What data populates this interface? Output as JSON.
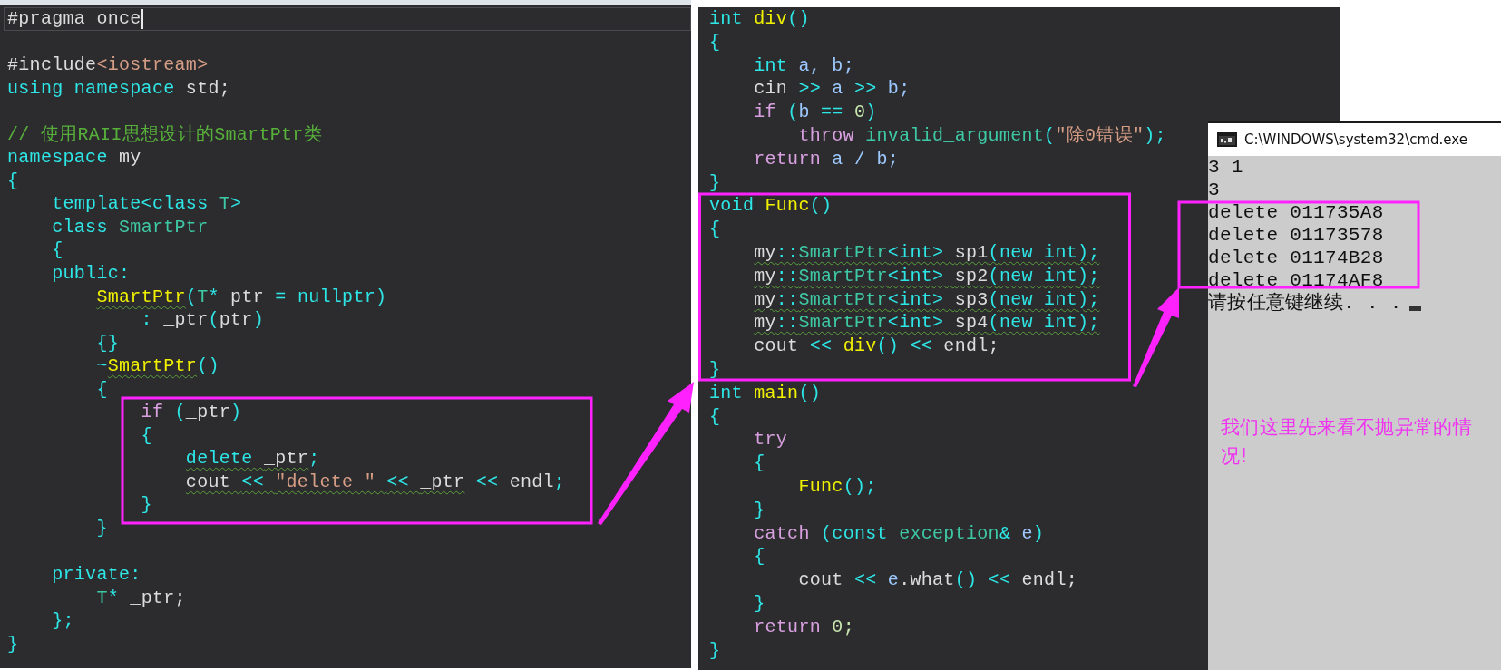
{
  "editors": [
    {
      "lines": [
        {
          "kind": "code",
          "current": true,
          "tokens": [
            {
              "text": "#pragma once",
              "kind": "id"
            }
          ]
        },
        {
          "kind": "blank"
        },
        {
          "kind": "code",
          "tokens": [
            {
              "text": "#include",
              "kind": "id"
            },
            {
              "text": "<iostream>",
              "kind": "str"
            }
          ]
        },
        {
          "kind": "code",
          "tokens": [
            {
              "text": "using namespace ",
              "kind": "kw"
            },
            {
              "text": "std;",
              "kind": "id"
            }
          ]
        },
        {
          "kind": "blank"
        },
        {
          "kind": "code",
          "tokens": [
            {
              "text": "// 使用RAII思想设计的SmartPtr类",
              "kind": "cmt"
            }
          ]
        },
        {
          "kind": "code",
          "tokens": [
            {
              "text": "namespace ",
              "kind": "kw"
            },
            {
              "text": "my",
              "kind": "id"
            }
          ]
        },
        {
          "kind": "code",
          "tokens": [
            {
              "text": "{",
              "kind": "punc"
            }
          ]
        },
        {
          "kind": "code",
          "tokens": [
            {
              "text": "    template<class ",
              "kind": "kw"
            },
            {
              "text": "T",
              "kind": "type"
            },
            {
              "text": ">",
              "kind": "punc"
            }
          ]
        },
        {
          "kind": "code",
          "tokens": [
            {
              "text": "    class ",
              "kind": "kw"
            },
            {
              "text": "SmartPtr",
              "kind": "type"
            }
          ]
        },
        {
          "kind": "code",
          "tokens": [
            {
              "text": "    {",
              "kind": "punc"
            }
          ]
        },
        {
          "kind": "code",
          "tokens": [
            {
              "text": "    public:",
              "kind": "kw"
            }
          ]
        },
        {
          "kind": "code",
          "tokens": [
            {
              "text": "        SmartPtr",
              "kind": "fn",
              "squiggly": true
            },
            {
              "text": "(",
              "kind": "punc"
            },
            {
              "text": "T",
              "kind": "type"
            },
            {
              "text": "* ",
              "kind": "punc"
            },
            {
              "text": "ptr ",
              "kind": "id"
            },
            {
              "text": "= ",
              "kind": "punc"
            },
            {
              "text": "nullptr",
              "kind": "kw"
            },
            {
              "text": ")",
              "kind": "punc"
            }
          ]
        },
        {
          "kind": "code",
          "tokens": [
            {
              "text": "            : ",
              "kind": "punc"
            },
            {
              "text": "_ptr",
              "kind": "id"
            },
            {
              "text": "(",
              "kind": "punc"
            },
            {
              "text": "ptr",
              "kind": "id"
            },
            {
              "text": ")",
              "kind": "punc"
            }
          ]
        },
        {
          "kind": "code",
          "tokens": [
            {
              "text": "        {}",
              "kind": "punc"
            }
          ]
        },
        {
          "kind": "code",
          "tokens": [
            {
              "text": "        ~",
              "kind": "punc"
            },
            {
              "text": "SmartPtr",
              "kind": "fn",
              "squiggly": true
            },
            {
              "text": "()",
              "kind": "punc"
            }
          ]
        },
        {
          "kind": "code",
          "tokens": [
            {
              "text": "        {",
              "kind": "punc"
            }
          ]
        },
        {
          "kind": "code",
          "tokens": [
            {
              "text": "            if ",
              "kind": "ctrl"
            },
            {
              "text": "(",
              "kind": "punc"
            },
            {
              "text": "_ptr",
              "kind": "id"
            },
            {
              "text": ")",
              "kind": "punc"
            }
          ]
        },
        {
          "kind": "code",
          "tokens": [
            {
              "text": "            {",
              "kind": "punc"
            }
          ]
        },
        {
          "kind": "code",
          "tokens": [
            {
              "text": "                delete ",
              "kind": "kw",
              "squiggly": true
            },
            {
              "text": "_ptr",
              "kind": "id",
              "squiggly": true
            },
            {
              "text": ";",
              "kind": "punc"
            }
          ]
        },
        {
          "kind": "code",
          "tokens": [
            {
              "text": "                cout ",
              "kind": "id",
              "squiggly": true
            },
            {
              "text": "<< ",
              "kind": "punc",
              "squiggly": true
            },
            {
              "text": "\"delete \" ",
              "kind": "str",
              "squiggly": true
            },
            {
              "text": "<< ",
              "kind": "punc",
              "squiggly": true
            },
            {
              "text": "_ptr",
              "kind": "id",
              "squiggly": true
            },
            {
              "text": " << ",
              "kind": "punc"
            },
            {
              "text": "endl",
              "kind": "id"
            },
            {
              "text": ";",
              "kind": "punc"
            }
          ]
        },
        {
          "kind": "code",
          "tokens": [
            {
              "text": "            }",
              "kind": "punc"
            }
          ]
        },
        {
          "kind": "code",
          "tokens": [
            {
              "text": "        }",
              "kind": "punc"
            }
          ]
        },
        {
          "kind": "blank"
        },
        {
          "kind": "code",
          "tokens": [
            {
              "text": "    private:",
              "kind": "kw"
            }
          ]
        },
        {
          "kind": "code",
          "tokens": [
            {
              "text": "        T",
              "kind": "type"
            },
            {
              "text": "* ",
              "kind": "punc"
            },
            {
              "text": "_ptr;",
              "kind": "id"
            }
          ]
        },
        {
          "kind": "code",
          "tokens": [
            {
              "text": "    };",
              "kind": "punc"
            }
          ]
        },
        {
          "kind": "code",
          "tokens": [
            {
              "text": "}",
              "kind": "punc"
            }
          ]
        }
      ]
    },
    {
      "lines": [
        {
          "kind": "code",
          "tokens": [
            {
              "text": "int ",
              "kind": "kw"
            },
            {
              "text": "div",
              "kind": "fn"
            },
            {
              "text": "()",
              "kind": "punc"
            }
          ]
        },
        {
          "kind": "code",
          "tokens": [
            {
              "text": "{",
              "kind": "punc"
            }
          ]
        },
        {
          "kind": "code",
          "tokens": [
            {
              "text": "    int ",
              "kind": "kw"
            },
            {
              "text": "a, b;",
              "kind": "var"
            }
          ]
        },
        {
          "kind": "code",
          "tokens": [
            {
              "text": "    cin ",
              "kind": "id"
            },
            {
              "text": ">> ",
              "kind": "punc"
            },
            {
              "text": "a ",
              "kind": "var"
            },
            {
              "text": ">> ",
              "kind": "punc"
            },
            {
              "text": "b;",
              "kind": "var"
            }
          ]
        },
        {
          "kind": "code",
          "tokens": [
            {
              "text": "    if ",
              "kind": "ctrl"
            },
            {
              "text": "(",
              "kind": "punc"
            },
            {
              "text": "b ",
              "kind": "var"
            },
            {
              "text": "== ",
              "kind": "punc"
            },
            {
              "text": "0",
              "kind": "num"
            },
            {
              "text": ")",
              "kind": "punc"
            }
          ]
        },
        {
          "kind": "code",
          "tokens": [
            {
              "text": "        throw ",
              "kind": "ctrl"
            },
            {
              "text": "invalid_argument",
              "kind": "type"
            },
            {
              "text": "(",
              "kind": "punc"
            },
            {
              "text": "\"除0错误\"",
              "kind": "str"
            },
            {
              "text": ");",
              "kind": "punc"
            }
          ]
        },
        {
          "kind": "code",
          "tokens": [
            {
              "text": "    return ",
              "kind": "ctrl"
            },
            {
              "text": "a / b;",
              "kind": "var"
            }
          ]
        },
        {
          "kind": "code",
          "tokens": [
            {
              "text": "}",
              "kind": "punc"
            }
          ]
        },
        {
          "kind": "code",
          "tokens": [
            {
              "text": "void ",
              "kind": "kw"
            },
            {
              "text": "Func",
              "kind": "fn"
            },
            {
              "text": "()",
              "kind": "punc"
            }
          ]
        },
        {
          "kind": "code",
          "tokens": [
            {
              "text": "{",
              "kind": "punc"
            }
          ]
        },
        {
          "kind": "code",
          "tokens": [
            {
              "text": "    my",
              "kind": "id",
              "squiggly": true
            },
            {
              "text": "::",
              "kind": "punc",
              "squiggly": true
            },
            {
              "text": "SmartPtr",
              "kind": "type",
              "squiggly": true
            },
            {
              "text": "<int> ",
              "kind": "kw",
              "squiggly": true
            },
            {
              "text": "sp1",
              "kind": "id",
              "squiggly": true
            },
            {
              "text": "(",
              "kind": "punc",
              "squiggly": true
            },
            {
              "text": "new int",
              "kind": "kw",
              "squiggly": true
            },
            {
              "text": ");",
              "kind": "punc",
              "squiggly": true
            }
          ]
        },
        {
          "kind": "code",
          "tokens": [
            {
              "text": "    my",
              "kind": "id",
              "squiggly": true
            },
            {
              "text": "::",
              "kind": "punc",
              "squiggly": true
            },
            {
              "text": "SmartPtr",
              "kind": "type",
              "squiggly": true
            },
            {
              "text": "<int> ",
              "kind": "kw",
              "squiggly": true
            },
            {
              "text": "sp2",
              "kind": "id",
              "squiggly": true
            },
            {
              "text": "(",
              "kind": "punc",
              "squiggly": true
            },
            {
              "text": "new int",
              "kind": "kw",
              "squiggly": true
            },
            {
              "text": ");",
              "kind": "punc",
              "squiggly": true
            }
          ]
        },
        {
          "kind": "code",
          "tokens": [
            {
              "text": "    my",
              "kind": "id",
              "squiggly": true
            },
            {
              "text": "::",
              "kind": "punc",
              "squiggly": true
            },
            {
              "text": "SmartPtr",
              "kind": "type",
              "squiggly": true
            },
            {
              "text": "<int> ",
              "kind": "kw",
              "squiggly": true
            },
            {
              "text": "sp3",
              "kind": "id",
              "squiggly": true
            },
            {
              "text": "(",
              "kind": "punc",
              "squiggly": true
            },
            {
              "text": "new int",
              "kind": "kw",
              "squiggly": true
            },
            {
              "text": ");",
              "kind": "punc",
              "squiggly": true
            }
          ]
        },
        {
          "kind": "code",
          "tokens": [
            {
              "text": "    my",
              "kind": "id",
              "squiggly": true
            },
            {
              "text": "::",
              "kind": "punc",
              "squiggly": true
            },
            {
              "text": "SmartPtr",
              "kind": "type",
              "squiggly": true
            },
            {
              "text": "<int> ",
              "kind": "kw",
              "squiggly": true
            },
            {
              "text": "sp4",
              "kind": "id",
              "squiggly": true
            },
            {
              "text": "(",
              "kind": "punc",
              "squiggly": true
            },
            {
              "text": "new int",
              "kind": "kw",
              "squiggly": true
            },
            {
              "text": ");",
              "kind": "punc",
              "squiggly": true
            }
          ]
        },
        {
          "kind": "code",
          "tokens": [
            {
              "text": "    cout ",
              "kind": "id"
            },
            {
              "text": "<< ",
              "kind": "punc"
            },
            {
              "text": "div",
              "kind": "fn"
            },
            {
              "text": "() ",
              "kind": "punc"
            },
            {
              "text": "<< ",
              "kind": "punc"
            },
            {
              "text": "endl;",
              "kind": "id"
            }
          ]
        },
        {
          "kind": "code",
          "tokens": [
            {
              "text": "}",
              "kind": "punc"
            }
          ]
        },
        {
          "kind": "code",
          "tokens": [
            {
              "text": "int ",
              "kind": "kw"
            },
            {
              "text": "main",
              "kind": "fn"
            },
            {
              "text": "()",
              "kind": "punc"
            }
          ]
        },
        {
          "kind": "code",
          "tokens": [
            {
              "text": "{",
              "kind": "punc"
            }
          ]
        },
        {
          "kind": "code",
          "tokens": [
            {
              "text": "    try",
              "kind": "ctrl"
            }
          ]
        },
        {
          "kind": "code",
          "tokens": [
            {
              "text": "    {",
              "kind": "punc"
            }
          ]
        },
        {
          "kind": "code",
          "tokens": [
            {
              "text": "        Func",
              "kind": "fn"
            },
            {
              "text": "();",
              "kind": "punc"
            }
          ]
        },
        {
          "kind": "code",
          "tokens": [
            {
              "text": "    }",
              "kind": "punc"
            }
          ]
        },
        {
          "kind": "code",
          "tokens": [
            {
              "text": "    catch ",
              "kind": "ctrl"
            },
            {
              "text": "(",
              "kind": "punc"
            },
            {
              "text": "const ",
              "kind": "kw"
            },
            {
              "text": "exception",
              "kind": "type"
            },
            {
              "text": "& ",
              "kind": "punc"
            },
            {
              "text": "e",
              "kind": "var"
            },
            {
              "text": ")",
              "kind": "punc"
            }
          ]
        },
        {
          "kind": "code",
          "tokens": [
            {
              "text": "    {",
              "kind": "punc"
            }
          ]
        },
        {
          "kind": "code",
          "tokens": [
            {
              "text": "        cout ",
              "kind": "id"
            },
            {
              "text": "<< ",
              "kind": "punc"
            },
            {
              "text": "e",
              "kind": "var"
            },
            {
              "text": ".what",
              "kind": "id"
            },
            {
              "text": "() ",
              "kind": "punc"
            },
            {
              "text": "<< ",
              "kind": "punc"
            },
            {
              "text": "endl;",
              "kind": "id"
            }
          ]
        },
        {
          "kind": "code",
          "tokens": [
            {
              "text": "    }",
              "kind": "punc"
            }
          ]
        },
        {
          "kind": "code",
          "tokens": [
            {
              "text": "    return ",
              "kind": "ctrl"
            },
            {
              "text": "0;",
              "kind": "num"
            }
          ]
        },
        {
          "kind": "code",
          "tokens": [
            {
              "text": "}",
              "kind": "punc"
            }
          ]
        }
      ]
    }
  ],
  "console": {
    "title": "C:\\WINDOWS\\system32\\cmd.exe",
    "lines": [
      "3 1",
      "3",
      "delete 011735A8",
      "delete 01173578",
      "delete 01174B28",
      "delete 01174AF8",
      "请按任意键继续. . ."
    ]
  },
  "annotation": "我们这里先来看不抛异常的情况!"
}
